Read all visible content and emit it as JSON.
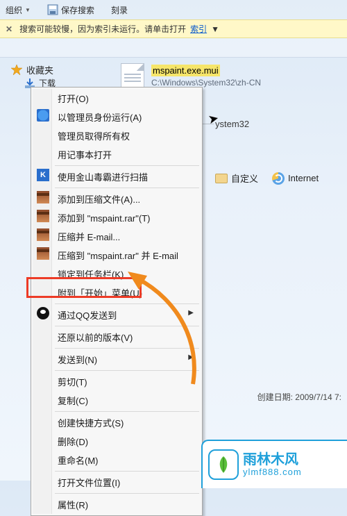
{
  "topbar": {
    "organize": "组织",
    "save_search": "保存搜索",
    "burn": "刻录"
  },
  "infostrip": {
    "text": "搜索可能较慢，因为索引未运行。请单击打开",
    "link": "索引"
  },
  "favorites": {
    "label": "收藏夹",
    "downloads": "下载"
  },
  "file": {
    "name": "mspaint.exe.mui",
    "path": "C:\\Windows\\System32\\zh-CN"
  },
  "breadcrumb": {
    "system32": "ystem32"
  },
  "right_items": {
    "customize": "自定义",
    "internet": "Internet"
  },
  "created": {
    "label": "创建日期:",
    "value": "2009/7/14 7:"
  },
  "context_menu": {
    "open": "打开(O)",
    "run_as_admin": "以管理员身份运行(A)",
    "admin_take_ownership": "管理员取得所有权",
    "open_with_notepad": "用记事本打开",
    "scan_jinshan": "使用金山毒霸进行扫描",
    "add_to_archive": "添加到压缩文件(A)...",
    "add_to_rar": "添加到 \"mspaint.rar\"(T)",
    "compress_email": "压缩并 E-mail...",
    "compress_rar_email": "压缩到 \"mspaint.rar\" 并 E-mail",
    "pin_taskbar": "锁定到任务栏(K)",
    "pin_start": "附到「开始」菜单(U)",
    "send_via_qq": "通过QQ发送到",
    "restore_previous": "还原以前的版本(V)",
    "send_to": "发送到(N)",
    "cut": "剪切(T)",
    "copy": "复制(C)",
    "create_shortcut": "创建快捷方式(S)",
    "delete": "删除(D)",
    "rename": "重命名(M)",
    "open_location": "打开文件位置(I)",
    "properties": "属性(R)"
  },
  "watermark": {
    "cn": "雨林木风",
    "en": "ylmf888.com"
  }
}
